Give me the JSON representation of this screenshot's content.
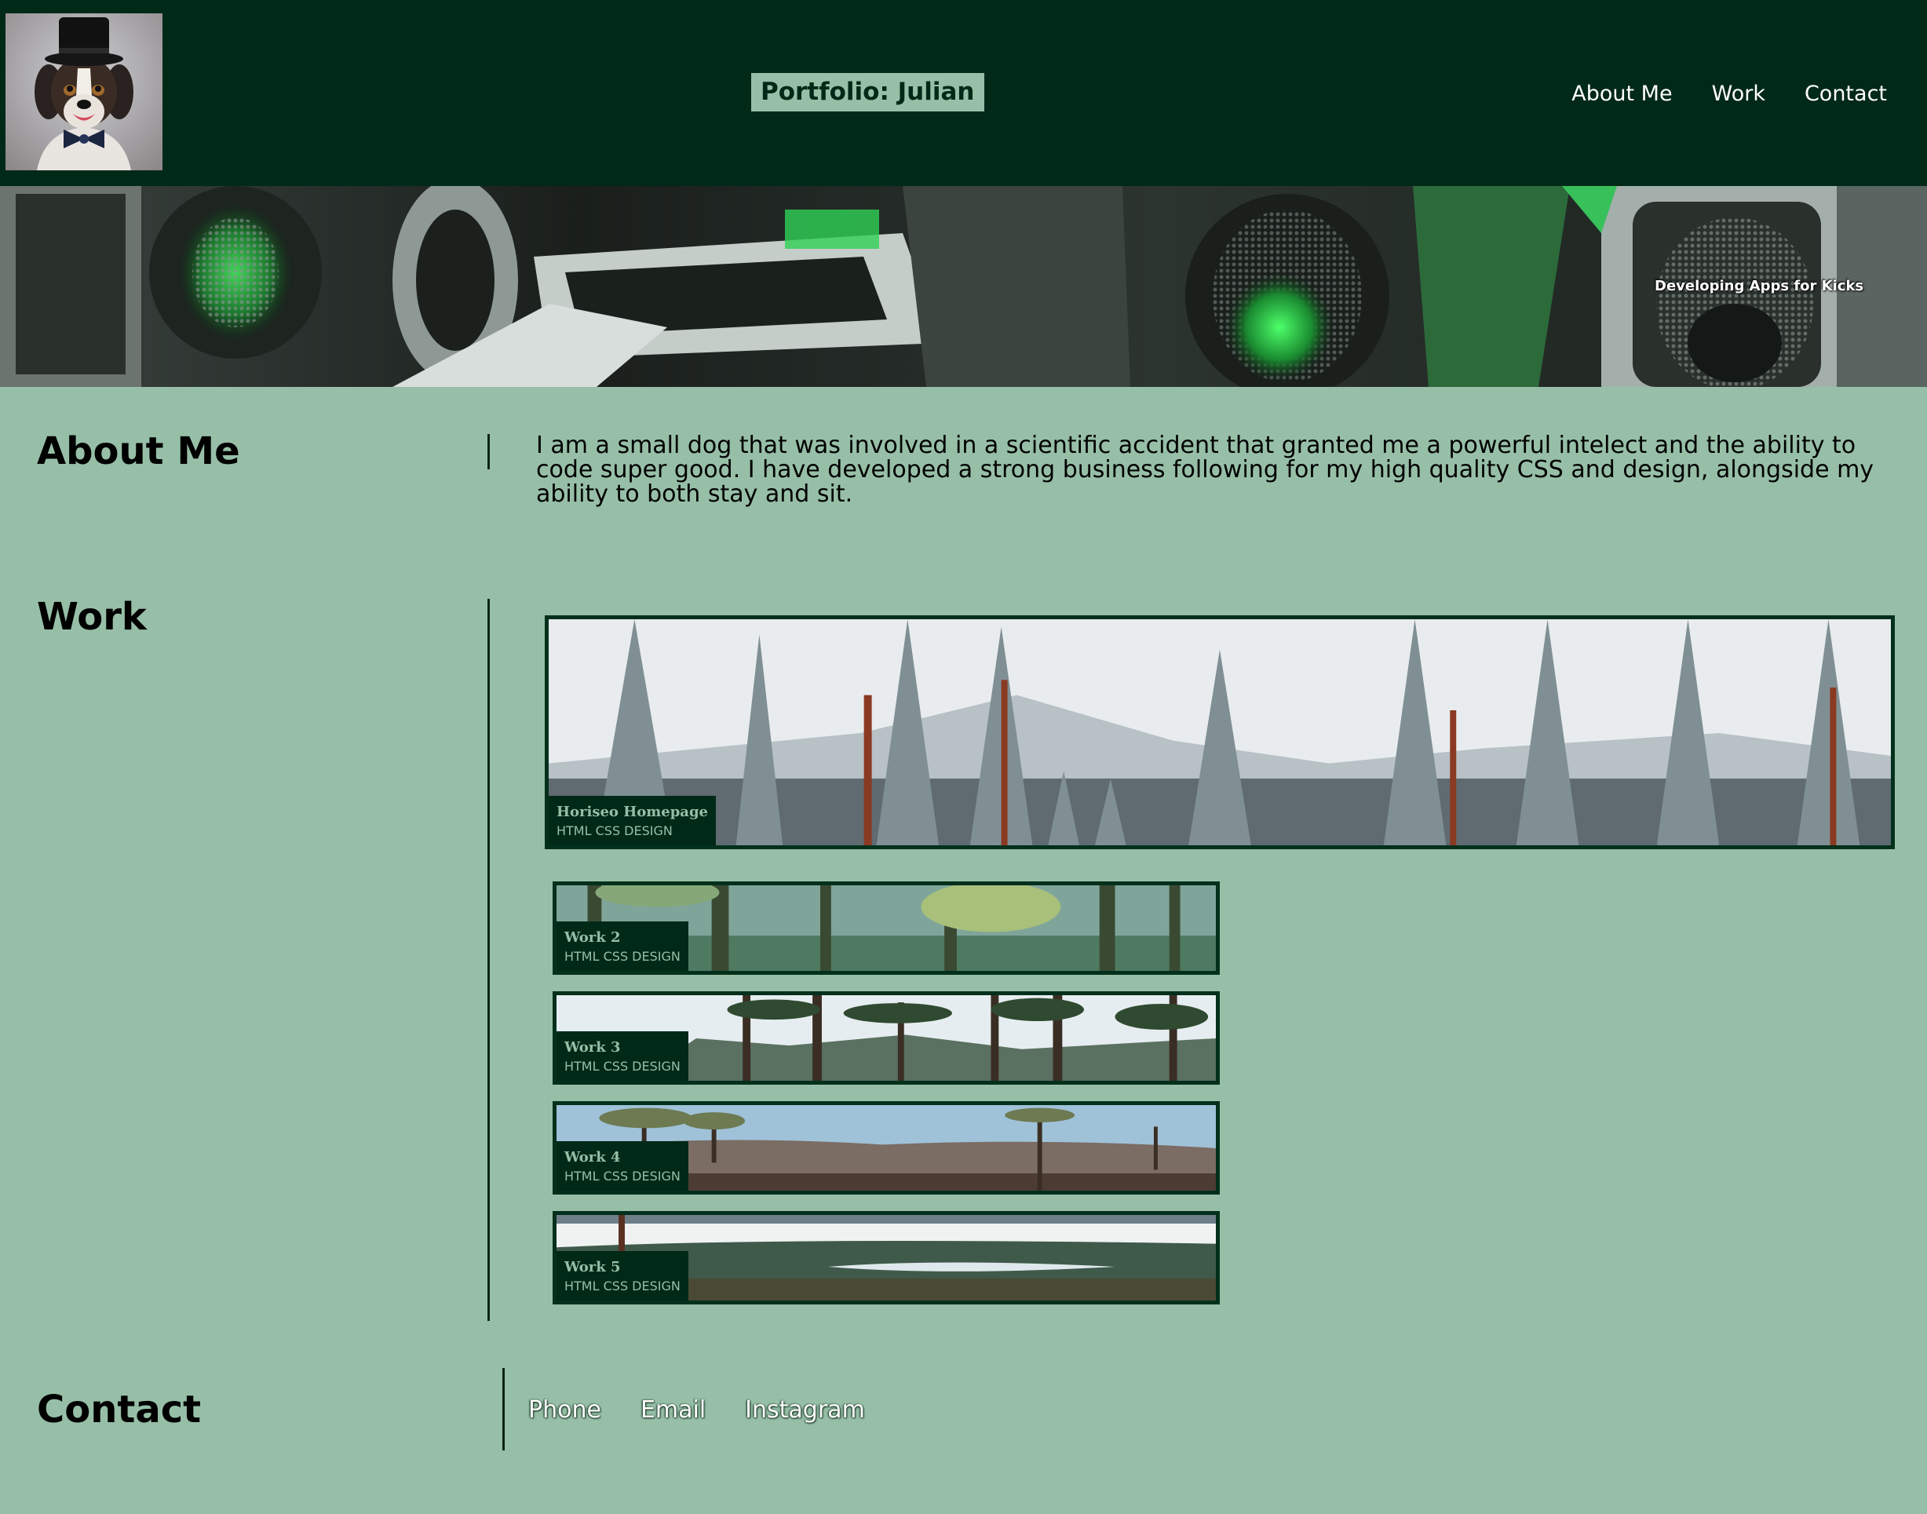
{
  "header": {
    "brand": "Portfolio: Julian",
    "nav": [
      "About Me",
      "Work",
      "Contact"
    ]
  },
  "hero": {
    "tagline": "Developing Apps for Kicks"
  },
  "about": {
    "title": "About Me",
    "text": "I am a small dog that was involved in a scientific accident that granted me a powerful intelect and the ability to code super good. I have developed a strong business following for my high quality CSS and design, alongside my ability to both stay and sit."
  },
  "work": {
    "title": "Work",
    "items": [
      {
        "title": "Horiseo Homepage",
        "subtitle": "HTML CSS DESIGN"
      },
      {
        "title": "Work 2",
        "subtitle": "HTML CSS DESIGN"
      },
      {
        "title": "Work 3",
        "subtitle": "HTML CSS DESIGN"
      },
      {
        "title": "Work 4",
        "subtitle": "HTML CSS DESIGN"
      },
      {
        "title": "Work 5",
        "subtitle": "HTML CSS DESIGN"
      }
    ]
  },
  "contact": {
    "title": "Contact",
    "links": [
      "Phone",
      "Email",
      "Instagram"
    ]
  },
  "colors": {
    "header_bg": "#012917",
    "page_bg": "#97bfa7",
    "card_border": "#01301c"
  }
}
